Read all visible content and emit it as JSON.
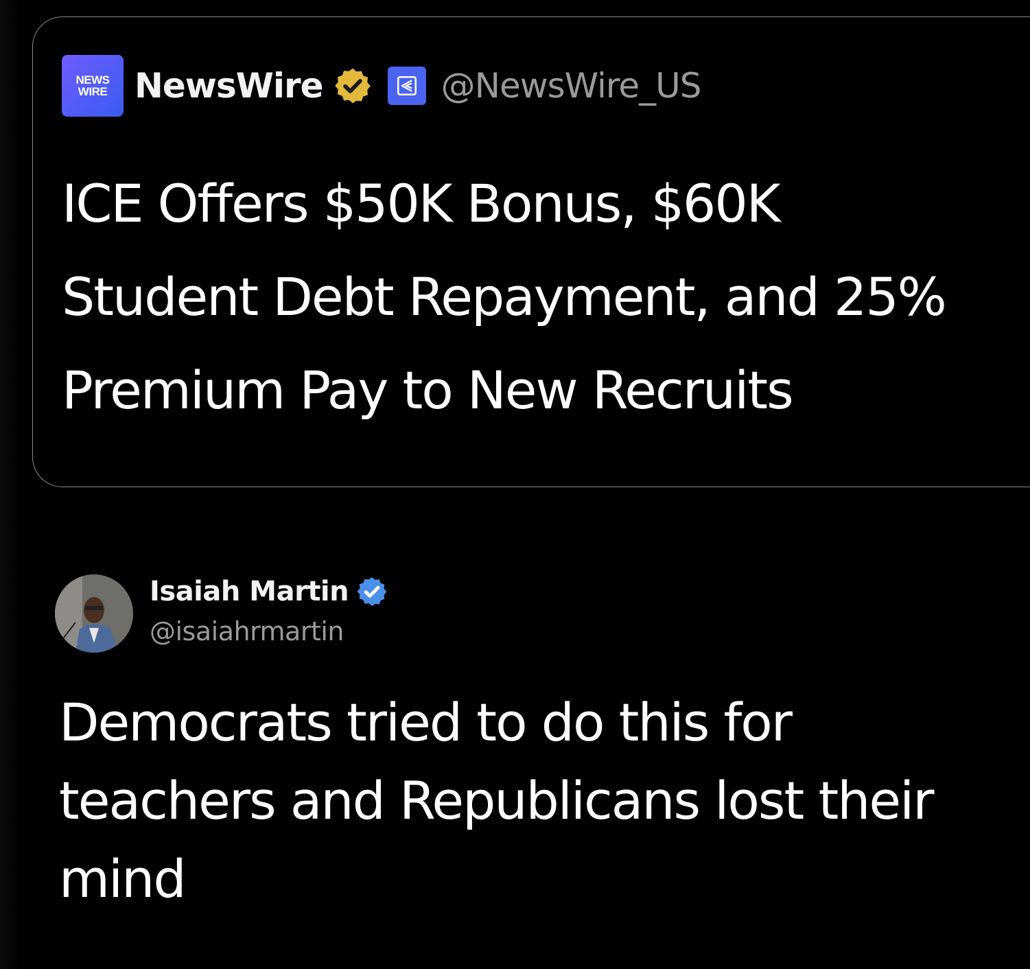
{
  "quoted_post": {
    "logo_line1": "NEWS",
    "logo_line2": "WIRE",
    "display_name": "NewsWire",
    "handle": "@NewsWire_US",
    "headline_lines": [
      "ICE Offers $50K Bonus, $60K",
      "Student Debt Repayment, and 25%",
      "Premium Pay to New Recruits"
    ]
  },
  "post": {
    "author_name": "Isaiah Martin",
    "author_handle": "@isaiahrmartin",
    "text": "Democrats tried to do this for teachers and Republicans lost their mind"
  },
  "colors": {
    "background": "#000000",
    "gold_badge": "#e2b93b",
    "blue_badge": "#4a8fe8",
    "affiliation_badge": "#4a63f0"
  }
}
